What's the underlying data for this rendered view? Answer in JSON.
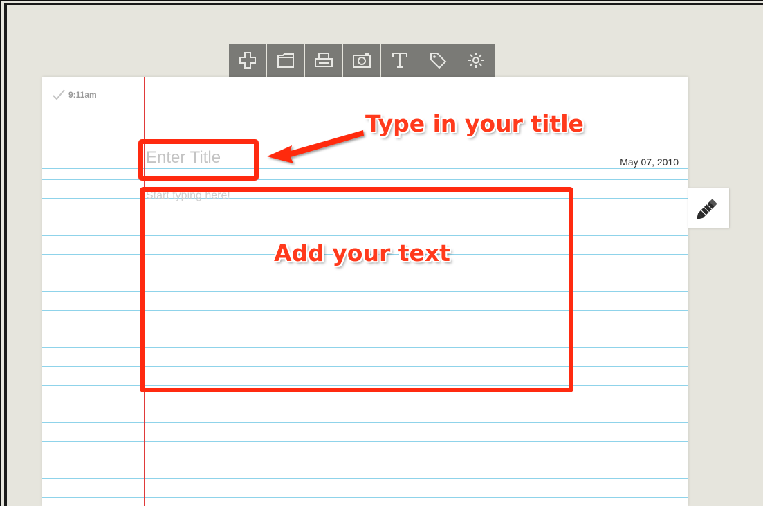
{
  "toolbar": {
    "buttons": [
      {
        "icon": "plus-icon"
      },
      {
        "icon": "folder-icon"
      },
      {
        "icon": "printer-icon"
      },
      {
        "icon": "camera-icon"
      },
      {
        "icon": "text-icon"
      },
      {
        "icon": "tag-icon"
      },
      {
        "icon": "gear-icon"
      }
    ]
  },
  "note": {
    "saved_time": "9:11am",
    "title_placeholder": "Enter Title",
    "date": "May 07, 2010",
    "body_placeholder": "Start typing here!"
  },
  "annotations": {
    "title_callout": "Type in your title",
    "body_callout": "Add your text",
    "color": "#ff2a10"
  },
  "colors": {
    "toolbar": "#7a7a76",
    "background": "#e6e5dd",
    "rule_line": "#8fd3ea",
    "margin_line": "#e03a3a"
  }
}
